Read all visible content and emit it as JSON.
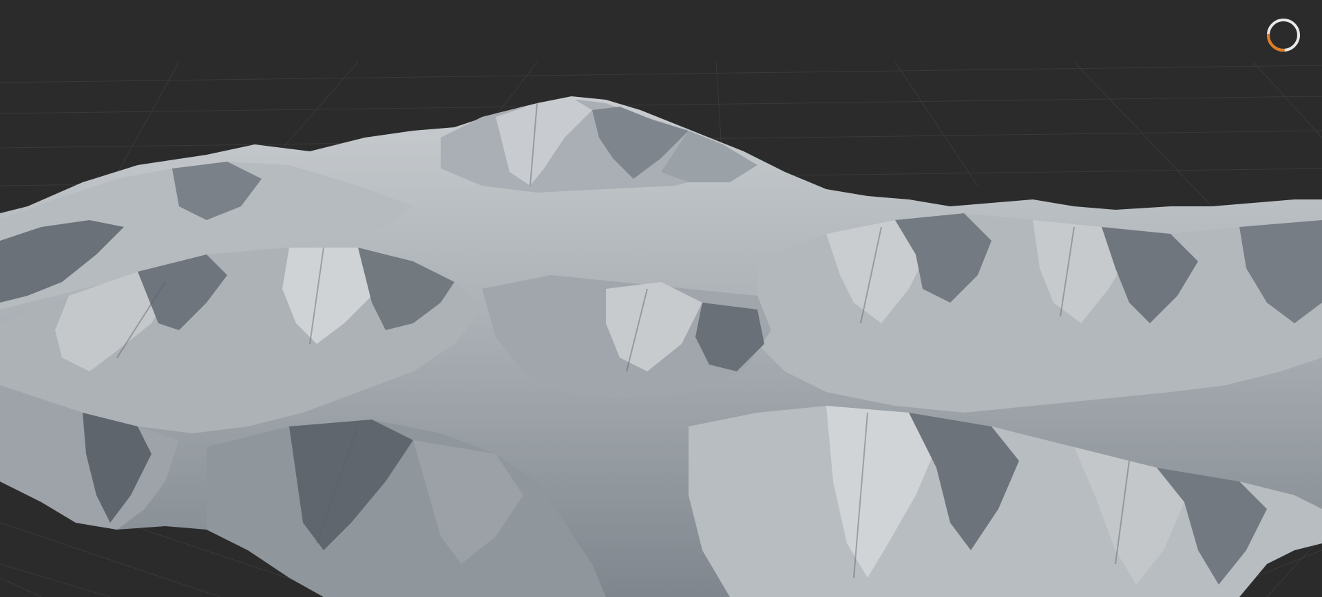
{
  "viewport": {
    "background": "#2b2b2b",
    "grid_color": "#3a3a3a",
    "terrain_light": "#b9bec2",
    "terrain_mid": "#8b9196",
    "terrain_shadow": "#545a62"
  },
  "gizmo": {
    "icon": "loading-ring-icon",
    "ring_color": "#e9e9e9",
    "accent_color": "#e07b22",
    "progress": 0.25
  }
}
